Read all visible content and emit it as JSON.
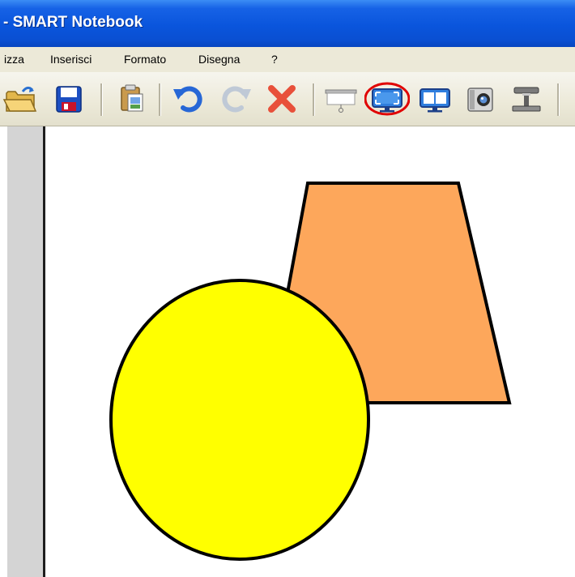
{
  "window": {
    "title": "- SMART Notebook"
  },
  "menu": {
    "items": [
      {
        "label": "izza"
      },
      {
        "label": "Inserisci"
      },
      {
        "label": "Formato"
      },
      {
        "label": "Disegna"
      },
      {
        "label": "?"
      }
    ]
  },
  "toolbar": {
    "buttons": [
      {
        "icon": "open-folder-icon"
      },
      {
        "icon": "save-icon"
      },
      {
        "icon": "paste-icon"
      },
      {
        "icon": "undo-icon"
      },
      {
        "icon": "redo-icon"
      },
      {
        "icon": "delete-icon"
      },
      {
        "icon": "screen-shade-icon"
      },
      {
        "icon": "full-screen-icon",
        "highlighted": true
      },
      {
        "icon": "dual-page-icon"
      },
      {
        "icon": "screen-capture-icon"
      },
      {
        "icon": "document-camera-icon"
      }
    ],
    "highlight_color": "#e00000"
  },
  "canvas": {
    "shapes": [
      {
        "type": "trapezoid",
        "fill": "#fda75b",
        "stroke": "#000000"
      },
      {
        "type": "ellipse",
        "fill": "#ffff00",
        "stroke": "#000000"
      }
    ]
  }
}
